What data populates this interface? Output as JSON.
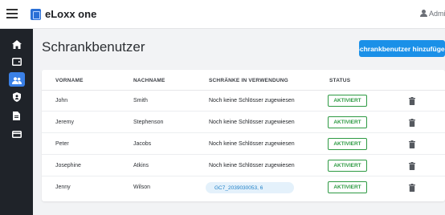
{
  "header": {
    "brand": "eLoxx one",
    "user_label": "Admi"
  },
  "sidebar": {
    "items": [
      {
        "icon": "home-icon",
        "active": false
      },
      {
        "icon": "tablet-icon",
        "active": false
      },
      {
        "icon": "users-icon",
        "active": true
      },
      {
        "icon": "shield-icon",
        "active": false
      },
      {
        "icon": "document-icon",
        "active": false
      },
      {
        "icon": "card-icon",
        "active": false
      }
    ]
  },
  "main": {
    "title": "Schrankbenutzer",
    "add_button": "Schrankbenutzer hinzufügen"
  },
  "table": {
    "headers": {
      "vorname": "VORNAME",
      "nachname": "NACHNAME",
      "schraenke": "SCHRÄNKE IN VERWENDUNG",
      "status": "STATUS"
    },
    "rows": [
      {
        "vorname": "John",
        "nachname": "Smith",
        "schraenke": "Noch keine Schlösser zugewiesen",
        "status": "AKTIVIERT",
        "chip": false
      },
      {
        "vorname": "Jeremy",
        "nachname": "Stephenson",
        "schraenke": "Noch keine Schlösser zugewiesen",
        "status": "AKTIVIERT",
        "chip": false
      },
      {
        "vorname": "Peter",
        "nachname": "Jacobs",
        "schraenke": "Noch keine Schlösser zugewiesen",
        "status": "AKTIVIERT",
        "chip": false
      },
      {
        "vorname": "Josephine",
        "nachname": "Atkins",
        "schraenke": "Noch keine Schlösser zugewiesen",
        "status": "AKTIVIERT",
        "chip": false
      },
      {
        "vorname": "Jenny",
        "nachname": "Wilson",
        "schraenke": "GC7_2039030053, 6",
        "status": "AKTIVIERT",
        "chip": true
      }
    ]
  },
  "colors": {
    "accent": "#1a90e8",
    "sidebar_bg": "#1f2329",
    "sidebar_active": "#3a80e6",
    "status_green": "#2e9a43"
  }
}
